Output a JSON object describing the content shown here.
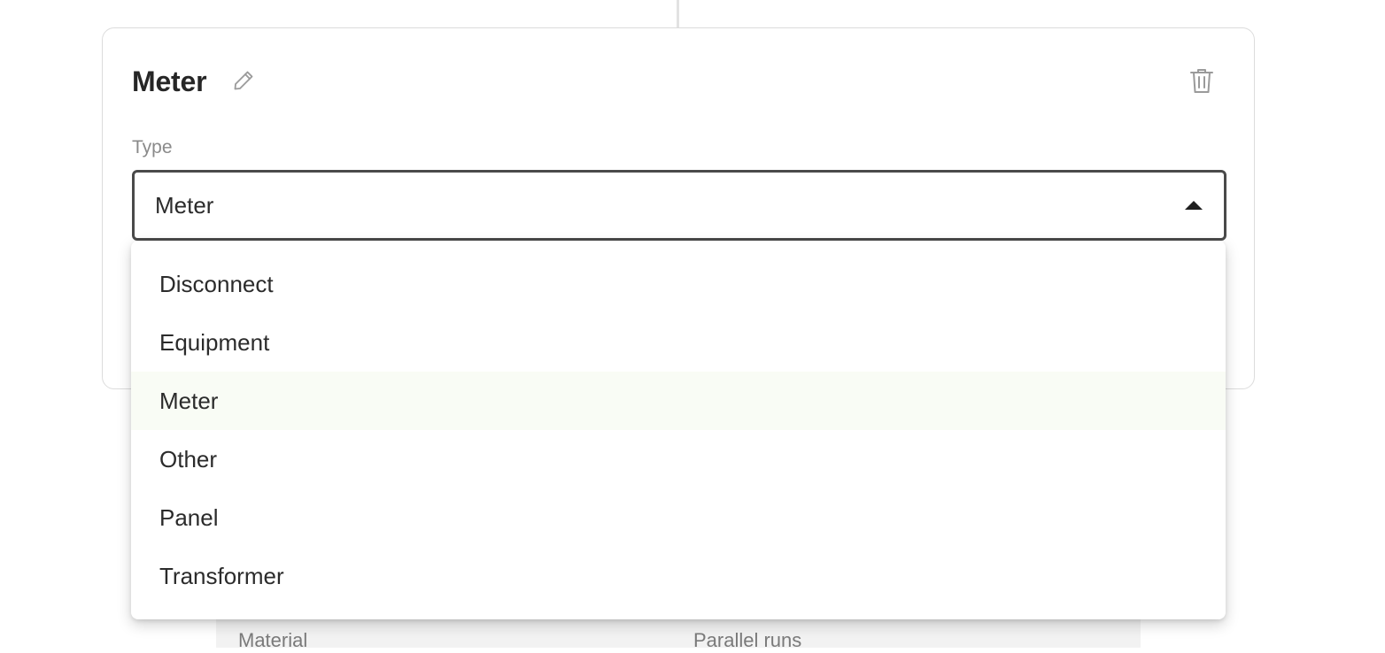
{
  "card": {
    "title": "Meter",
    "type_field": {
      "label": "Type",
      "value": "Meter",
      "expanded": true,
      "options": [
        {
          "label": "Disconnect",
          "selected": false
        },
        {
          "label": "Equipment",
          "selected": false
        },
        {
          "label": "Meter",
          "selected": true
        },
        {
          "label": "Other",
          "selected": false
        },
        {
          "label": "Panel",
          "selected": false
        },
        {
          "label": "Transformer",
          "selected": false
        }
      ]
    }
  },
  "background": {
    "material_label": "Material",
    "parallel_runs_label": "Parallel runs"
  },
  "icons": {
    "edit": "pencil-icon",
    "delete": "trash-icon",
    "dropdown": "caret-up-icon"
  },
  "colors": {
    "selected_option_bg": "#f9fcf5",
    "select_border": "#4a4a4a",
    "card_border": "#dcdcdc"
  }
}
